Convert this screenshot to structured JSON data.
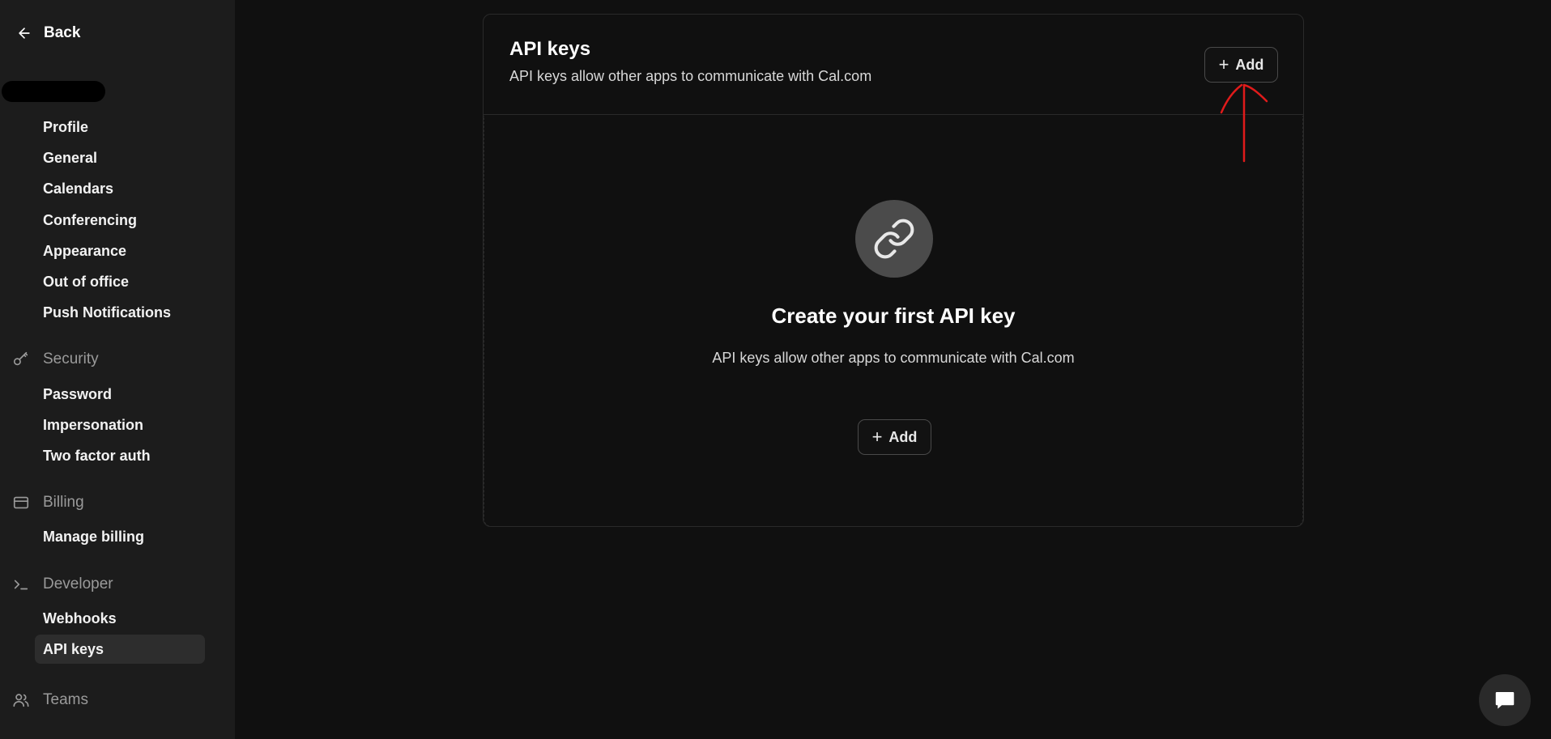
{
  "sidebar": {
    "back_label": "Back",
    "profile_items": [
      "Profile",
      "General",
      "Calendars",
      "Conferencing",
      "Appearance",
      "Out of office",
      "Push Notifications"
    ],
    "security": {
      "title": "Security",
      "icon": "key-icon",
      "items": [
        "Password",
        "Impersonation",
        "Two factor auth"
      ]
    },
    "billing": {
      "title": "Billing",
      "icon": "credit-card-icon",
      "items": [
        "Manage billing"
      ]
    },
    "developer": {
      "title": "Developer",
      "icon": "terminal-icon",
      "items": [
        "Webhooks",
        "API keys"
      ],
      "active": "API keys"
    },
    "teams": {
      "title": "Teams",
      "icon": "users-icon"
    }
  },
  "main": {
    "title": "API keys",
    "subtitle": "API keys allow other apps to communicate with Cal.com",
    "add_label": "Add",
    "empty": {
      "icon": "link-icon",
      "title": "Create your first API key",
      "subtitle": "API keys allow other apps to communicate with Cal.com",
      "add_label": "Add"
    }
  },
  "chat": {
    "icon": "chat-bubble-icon"
  },
  "colors": {
    "background": "#101010",
    "sidebar": "#1c1c1c",
    "annotation": "#e01b1b"
  }
}
